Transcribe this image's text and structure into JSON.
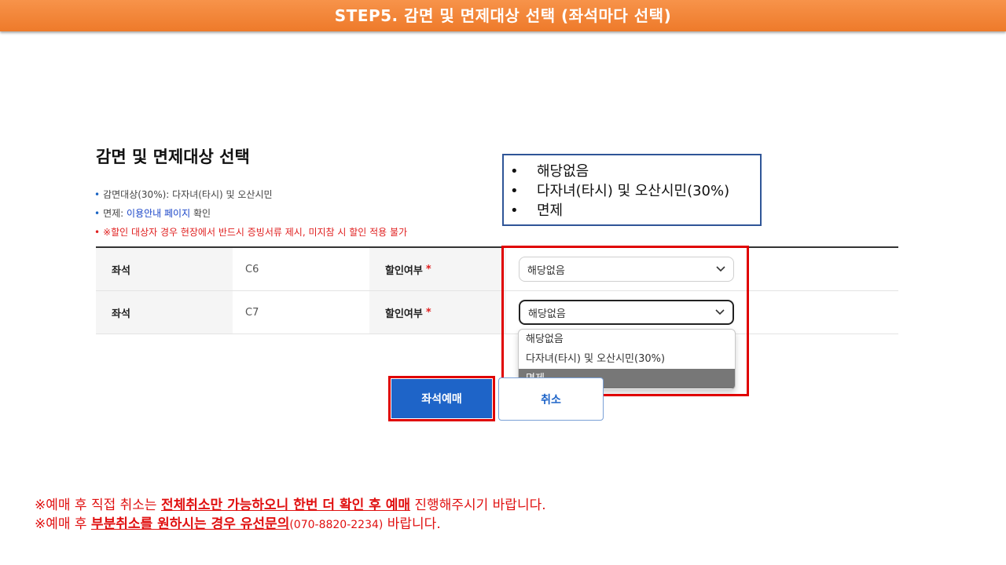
{
  "banner": {
    "title": "STEP5. 감면 및 면제대상 선택 (좌석마다 선택)"
  },
  "section": {
    "title": "감면 및 면제대상 선택",
    "notes": {
      "reduction": "감면대상(30%): 다자녀(타시) 및 오산시민",
      "exemption_prefix": "면제: ",
      "exemption_link": "이용안내 페이지",
      "exemption_suffix": " 확인",
      "warning": "※할인 대상자 경우 현장에서 반드시 증빙서류 제시, 미지참 시 할인 적용 불가"
    }
  },
  "table": {
    "seat_label": "좌석",
    "discount_label": "할인여부",
    "required_mark": "*",
    "rows": [
      {
        "seat": "C6",
        "selected": "해당없음"
      },
      {
        "seat": "C7",
        "selected": "해당없음"
      }
    ]
  },
  "dropdown": {
    "options": [
      "해당없음",
      "다자녀(타시) 및 오산시민(30%)",
      "면제"
    ],
    "highlighted_index": 2
  },
  "callout": {
    "bullet": "•",
    "items": [
      "해당없음",
      "다자녀(타시) 및 오산시민(30%)",
      "면제"
    ]
  },
  "buttons": {
    "reserve": "좌석예매",
    "cancel": "취소"
  },
  "footer": {
    "line1_a": "※예매 후 직접 취소는 ",
    "line1_b": "전체취소만 가능하오니 한번 더 확인 후 예매",
    "line1_c": " 진행해주시기 바랍니다.",
    "line2_a": "※예매 후 ",
    "line2_b": "부분취소를 원하시는 경우 유선문의",
    "line2_c": "(070-8820-2234)",
    "line2_d": " 바랍니다."
  },
  "colors": {
    "banner": "#ee7a2a",
    "primary": "#1e64c8",
    "highlight": "#e00000",
    "callout_border": "#2f5597"
  }
}
